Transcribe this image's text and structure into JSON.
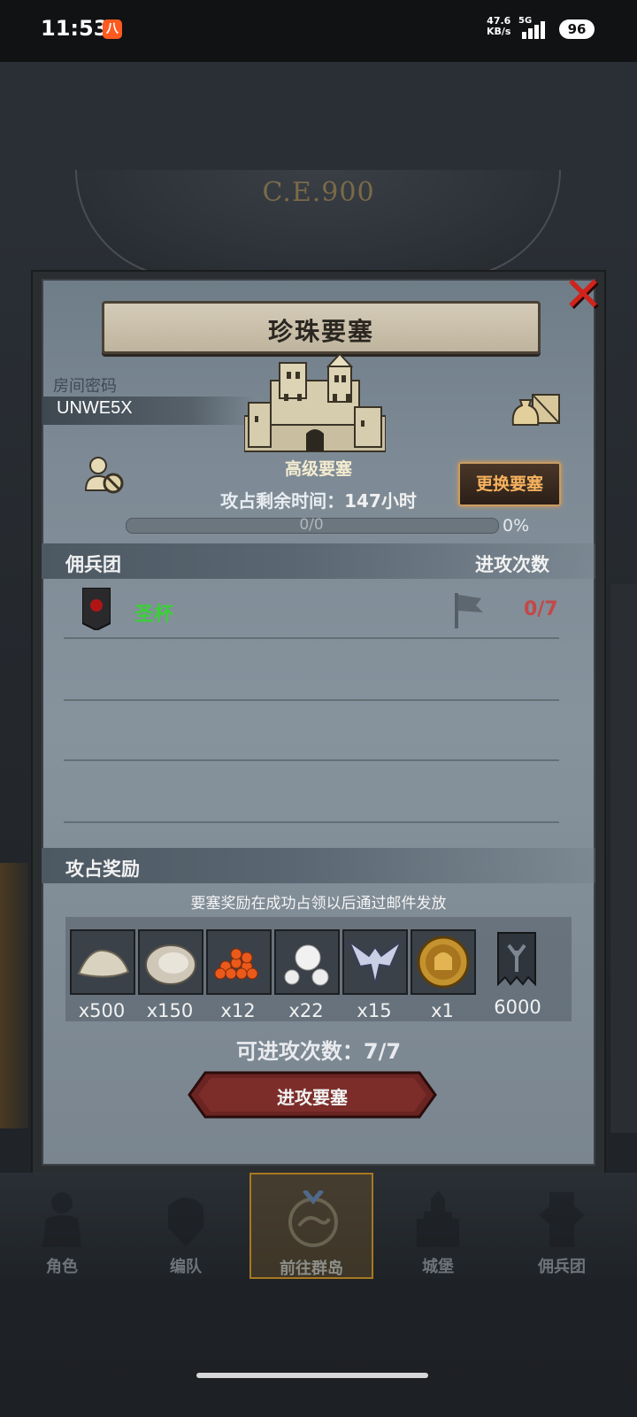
{
  "status_bar": {
    "time": "11:53",
    "app_icon": "八",
    "net_speed_value": "47.6",
    "net_speed_unit": "KB/s",
    "network": "5G",
    "battery": "96"
  },
  "background": {
    "era": "C.E.900"
  },
  "dialog": {
    "title": "珍珠要塞",
    "room_label": "房间密码",
    "room_code": "UNWE5X",
    "fort_level": "高级要塞",
    "time_left_label": "攻占剩余时间：",
    "time_left_value": "147",
    "time_left_unit": "小时",
    "change_button": "更换要塞",
    "progress_text": "0/0",
    "progress_percent": "0%",
    "progress_value": 0,
    "mercenary_section": {
      "title": "佣兵团",
      "right_title": "进攻次数",
      "rows": [
        {
          "name": "圣杯",
          "attacks": "0/7"
        }
      ]
    },
    "reward_section": {
      "title": "攻占奖励",
      "note": "要塞奖励在成功占领以后通过邮件发放",
      "items": [
        {
          "icon": "flour-pile-icon",
          "qty": "x500"
        },
        {
          "icon": "oyster-icon",
          "qty": "x150"
        },
        {
          "icon": "roe-icon",
          "qty": "x12"
        },
        {
          "icon": "pearls-icon",
          "qty": "x22"
        },
        {
          "icon": "helmet-crest-icon",
          "qty": "x15"
        },
        {
          "icon": "knight-coin-icon",
          "qty": "x1"
        },
        {
          "icon": "banner-icon",
          "qty": "6000"
        }
      ]
    },
    "attacks_available_label": "可进攻次数：",
    "attacks_available_value": "7/7",
    "attack_button": "进攻要塞"
  },
  "nav": {
    "items": [
      {
        "label": "角色",
        "icon": "character-icon"
      },
      {
        "label": "编队",
        "icon": "formation-icon"
      },
      {
        "label": "前往群岛",
        "icon": "island-icon",
        "active": true
      },
      {
        "label": "城堡",
        "icon": "castle-icon"
      },
      {
        "label": "佣兵团",
        "icon": "mercenary-icon"
      }
    ]
  },
  "colors": {
    "accent_orange": "#f6b25e",
    "guild_green": "#3ccf3a",
    "count_red": "#c34848",
    "close_red": "#d2231b"
  }
}
